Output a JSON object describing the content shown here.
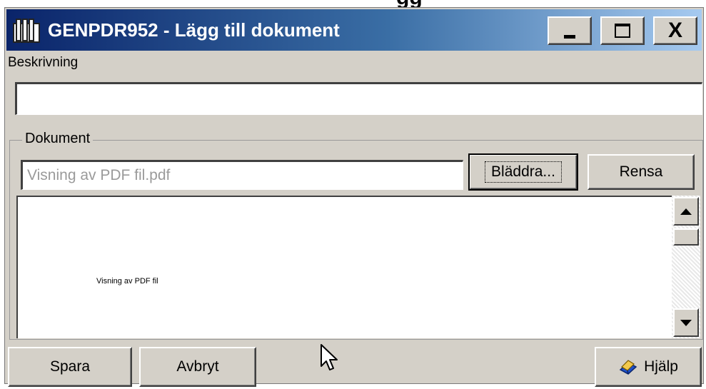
{
  "cropped_heading": "gg",
  "window": {
    "title": "GENPDR952 - Lägg till dokument"
  },
  "titlebar_buttons": {
    "minimize": "_",
    "maximize": "□",
    "close": "X"
  },
  "form": {
    "description_label": "Beskrivning",
    "description_value": "",
    "document_group_label": "Dokument",
    "document_field_value": "Visning av PDF fil.pdf",
    "browse_label": "Bläddra...",
    "clear_label": "Rensa",
    "preview_text": "Visning av PDF fil"
  },
  "footer": {
    "save_label": "Spara",
    "cancel_label": "Avbryt",
    "help_label": "Hjälp"
  },
  "colors": {
    "titlebar_start": "#0a246a",
    "titlebar_end": "#a6caf0",
    "window_bg": "#d4d0c8"
  },
  "icons": [
    "app-icon",
    "minimize-icon",
    "maximize-icon",
    "close-icon",
    "scroll-up-icon",
    "scroll-down-icon",
    "help-book-icon",
    "mouse-cursor-icon"
  ]
}
